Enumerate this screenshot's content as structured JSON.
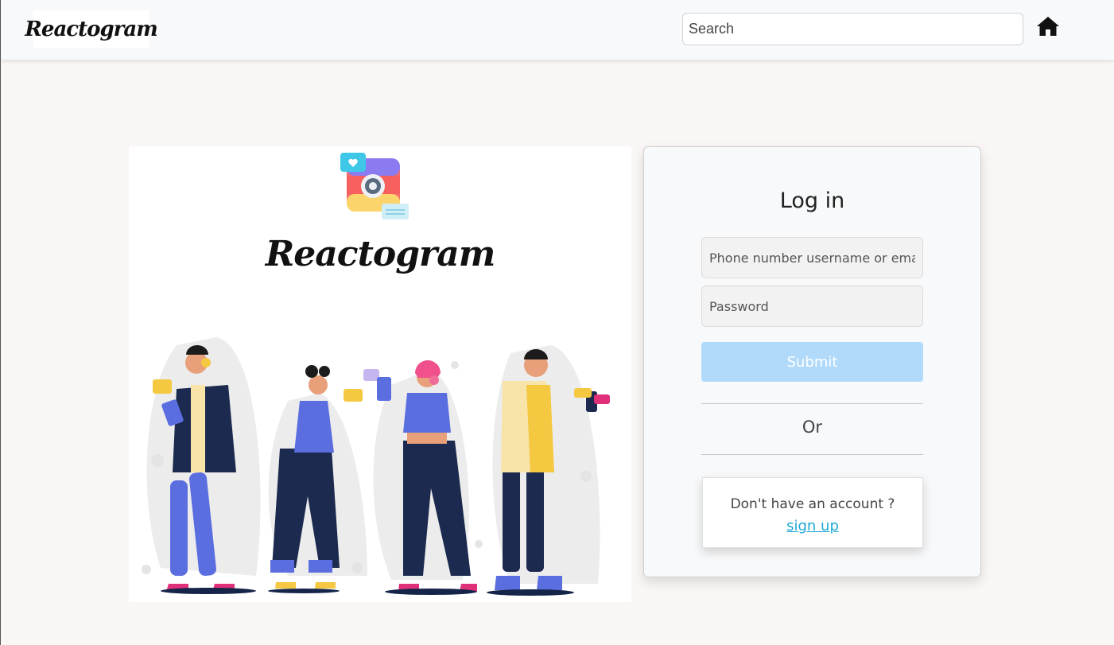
{
  "navbar": {
    "brand": "Reactogram",
    "search_placeholder": "Search"
  },
  "hero": {
    "title": "Reactogram"
  },
  "login": {
    "title": "Log in",
    "username_placeholder": "Phone number username or email",
    "password_placeholder": "Password",
    "submit_label": "Submit",
    "or_label": "Or",
    "no_account_text": "Don't have an account ?",
    "signup_label": "sign up"
  },
  "colors": {
    "submit_bg": "#b1dafa",
    "link": "#1fa9d6",
    "page_bg": "#faf6f5"
  }
}
